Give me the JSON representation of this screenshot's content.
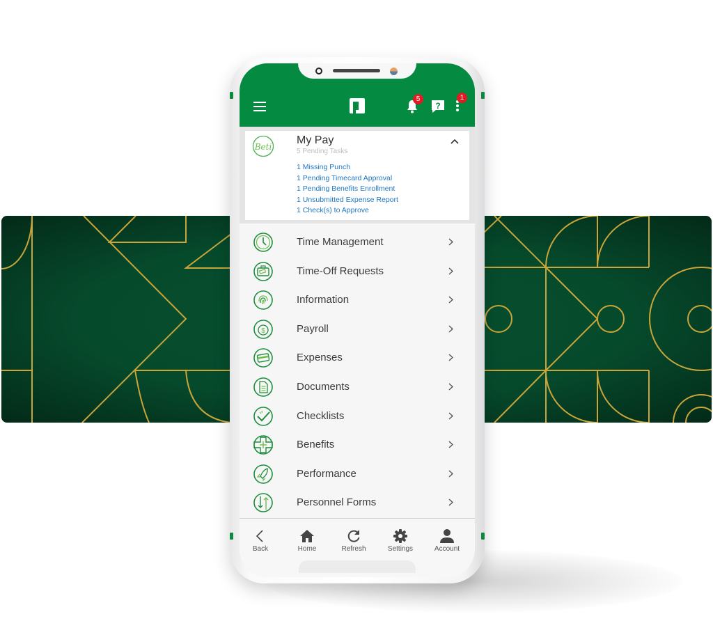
{
  "colors": {
    "brand_green": "#058a42",
    "link_blue": "#1e77c2",
    "badge_red": "#e21b23",
    "banner_green": "#064a2c",
    "banner_gold": "#c9a53a"
  },
  "appbar": {
    "menu_icon": "hamburger-icon",
    "logo_icon": "paycom-logo",
    "notifications": {
      "icon": "bell-icon",
      "badge": "5"
    },
    "help": {
      "icon": "help-icon"
    },
    "more": {
      "icon": "kebab-icon",
      "badge": "1"
    }
  },
  "my_pay": {
    "avatar": "Beti",
    "title": "My Pay",
    "subtitle": "5 Pending Tasks",
    "tasks": [
      "1 Missing Punch",
      "1 Pending Timecard Approval",
      "1 Pending Benefits Enrollment",
      "1 Unsubmitted Expense Report",
      "1 Check(s) to Approve"
    ]
  },
  "menu": [
    {
      "label": "Time Management",
      "icon": "clock-icon"
    },
    {
      "label": "Time-Off Requests",
      "icon": "suitcase-icon"
    },
    {
      "label": "Information",
      "icon": "fingerprint-icon"
    },
    {
      "label": "Payroll",
      "icon": "money-bag-icon"
    },
    {
      "label": "Expenses",
      "icon": "credit-card-icon"
    },
    {
      "label": "Documents",
      "icon": "document-icon"
    },
    {
      "label": "Checklists",
      "icon": "checkmark-icon"
    },
    {
      "label": "Benefits",
      "icon": "medical-cross-icon"
    },
    {
      "label": "Performance",
      "icon": "rocket-icon"
    },
    {
      "label": "Personnel Forms",
      "icon": "transfer-arrows-icon"
    }
  ],
  "bottom_nav": [
    {
      "label": "Back",
      "icon": "back-icon"
    },
    {
      "label": "Home",
      "icon": "home-icon"
    },
    {
      "label": "Refresh",
      "icon": "refresh-icon"
    },
    {
      "label": "Settings",
      "icon": "gear-icon"
    },
    {
      "label": "Account",
      "icon": "user-icon"
    }
  ]
}
